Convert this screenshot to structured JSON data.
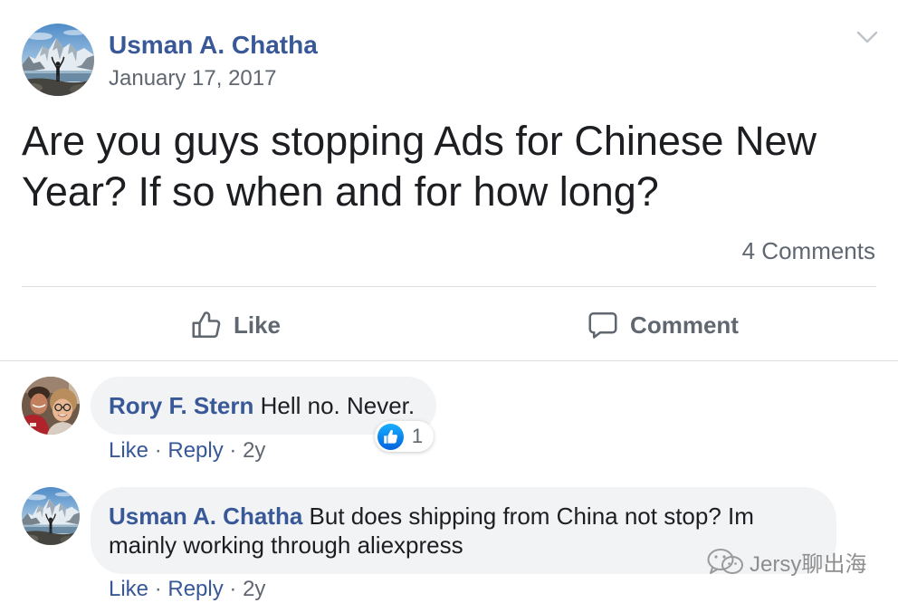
{
  "post": {
    "author": "Usman A. Chatha",
    "date": "January 17, 2017",
    "text": "Are you guys stopping Ads for Chinese New Year? If so when and for how long?",
    "comment_count": "4 Comments",
    "menu_icon": "chevron-down-icon",
    "avatar_icon": "profile-photo-mountain-lake"
  },
  "actions": {
    "like_label": "Like",
    "comment_label": "Comment",
    "like_icon": "thumbs-up-icon",
    "comment_icon": "speech-bubble-icon"
  },
  "meta_separator": "·",
  "comments": [
    {
      "author": "Rory F. Stern",
      "text": "Hell no. Never.",
      "avatar_icon": "profile-photo-selfie",
      "reaction_icon": "like-reaction-icon",
      "reaction_count": "1",
      "like_label": "Like",
      "reply_label": "Reply",
      "age": "2y"
    },
    {
      "author": "Usman A. Chatha",
      "text": "But does shipping from China not stop? Im mainly working through aliexpress",
      "avatar_icon": "profile-photo-mountain-lake",
      "like_label": "Like",
      "reply_label": "Reply",
      "age": "2y"
    }
  ],
  "watermark": {
    "text": "Jersy聊出海",
    "icon": "wechat-icon"
  },
  "colors": {
    "link": "#385898",
    "text": "#1c1e21",
    "secondary": "#606770",
    "bubble": "#f2f3f5",
    "divider": "#dadde1",
    "reaction": "#1877f2"
  }
}
